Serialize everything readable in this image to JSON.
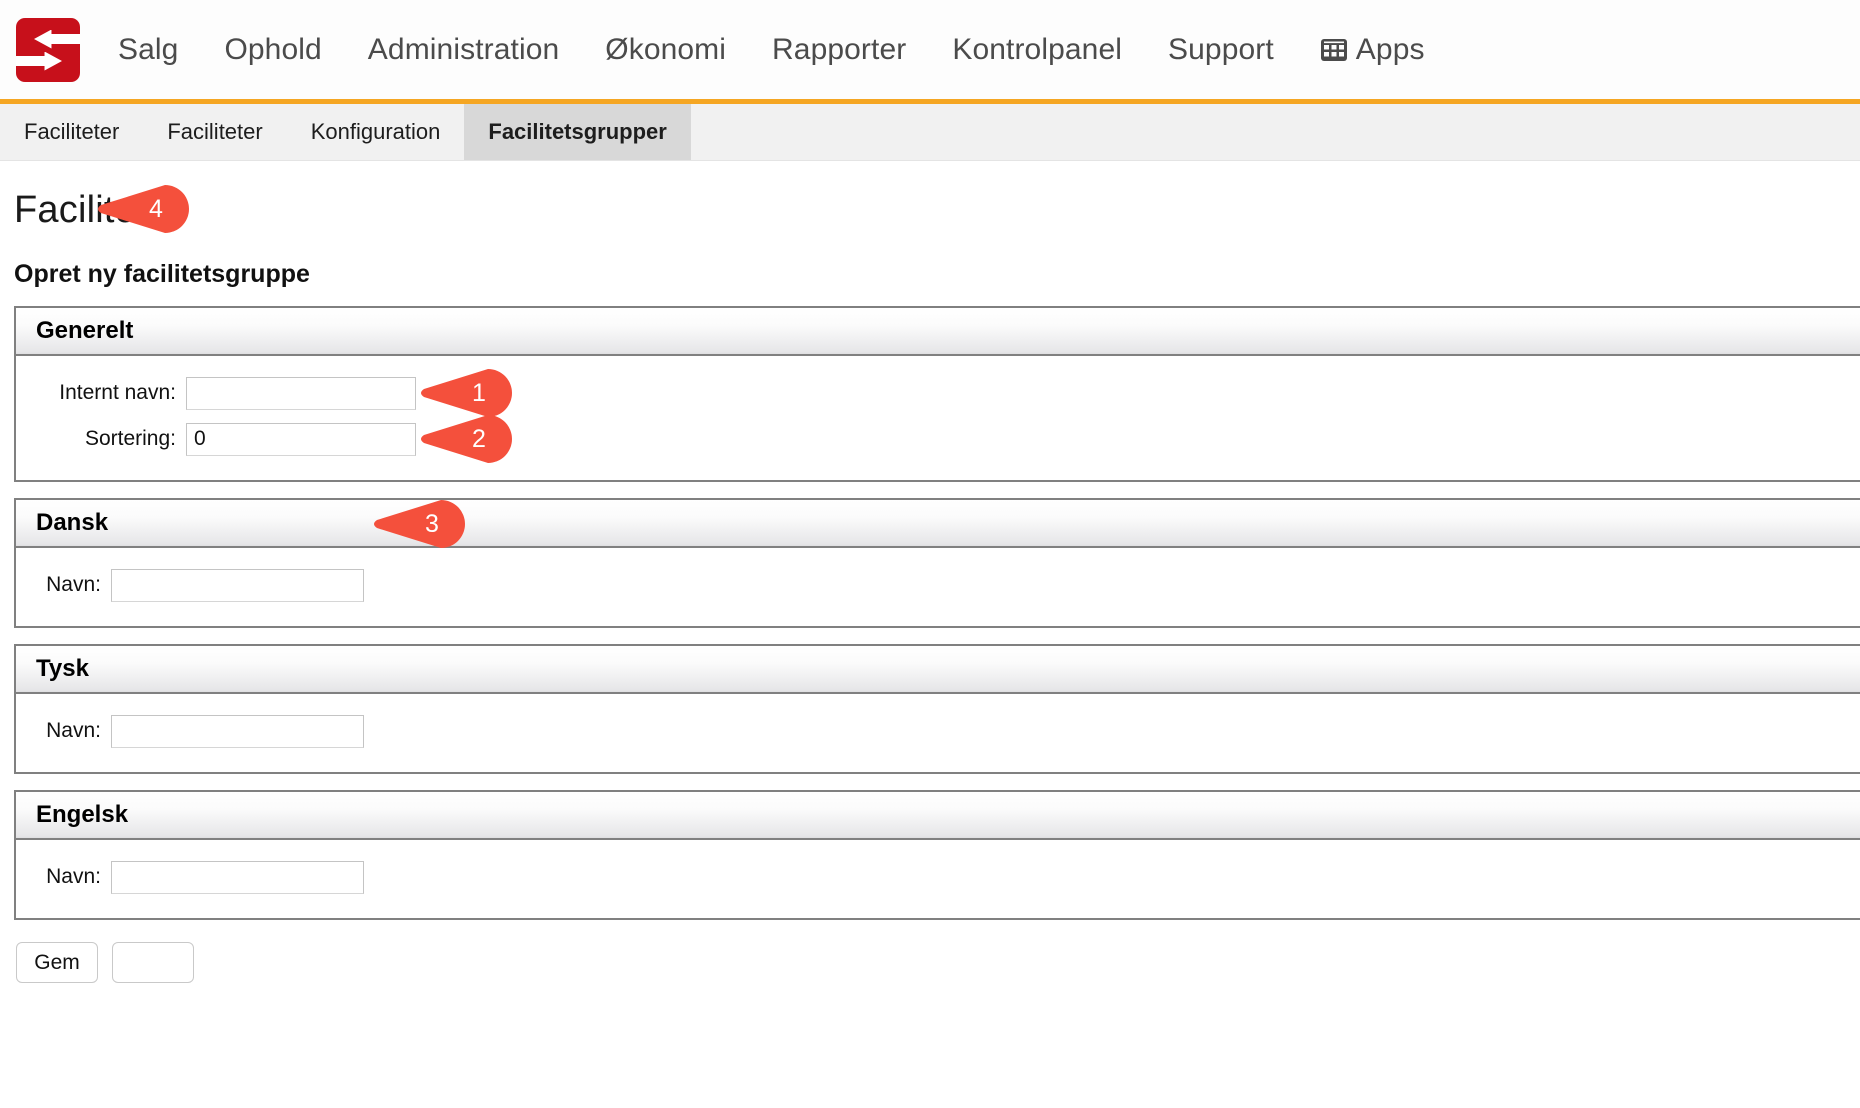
{
  "topnav": {
    "logo_name": "servicebooking-logo",
    "brand_color": "#C7101B",
    "accent_color": "#F5A623",
    "items": [
      {
        "label": "Salg",
        "name": "nav-salg"
      },
      {
        "label": "Ophold",
        "name": "nav-ophold"
      },
      {
        "label": "Administration",
        "name": "nav-administration"
      },
      {
        "label": "Økonomi",
        "name": "nav-okonomi"
      },
      {
        "label": "Rapporter",
        "name": "nav-rapporter"
      },
      {
        "label": "Kontrolpanel",
        "name": "nav-kontrolpanel"
      },
      {
        "label": "Support",
        "name": "nav-support"
      }
    ],
    "apps": {
      "label": "Apps",
      "icon": "grid-icon"
    }
  },
  "tabbar": {
    "tabs": [
      {
        "label": "Faciliteter",
        "active": false
      },
      {
        "label": "Faciliteter",
        "active": false
      },
      {
        "label": "Konfiguration",
        "active": false
      },
      {
        "label": "Facilitetsgrupper",
        "active": true
      }
    ]
  },
  "page": {
    "title": "Faciliteter",
    "subtitle": "Opret ny facilitetsgruppe"
  },
  "sections": {
    "generelt": {
      "title": "Generelt",
      "fields": [
        {
          "label": "Internt navn:",
          "value": "",
          "placeholder": ""
        },
        {
          "label": "Sortering:",
          "value": "0",
          "placeholder": ""
        }
      ]
    },
    "dansk": {
      "title": "Dansk",
      "fields": [
        {
          "label": "Navn:",
          "value": "",
          "placeholder": ""
        }
      ]
    },
    "tysk": {
      "title": "Tysk",
      "fields": [
        {
          "label": "Navn:",
          "value": "",
          "placeholder": ""
        }
      ]
    },
    "engelsk": {
      "title": "Engelsk",
      "fields": [
        {
          "label": "Navn:",
          "value": "",
          "placeholder": ""
        }
      ]
    }
  },
  "buttons": {
    "save_label": "Gem",
    "secondary_label": ""
  },
  "callouts": {
    "color": "#F4503C",
    "items": [
      {
        "number": "1",
        "target": "internt-navn-input"
      },
      {
        "number": "2",
        "target": "sortering-input"
      },
      {
        "number": "3",
        "target": "dansk-section-header"
      },
      {
        "number": "4",
        "target": "gem-button"
      }
    ]
  }
}
